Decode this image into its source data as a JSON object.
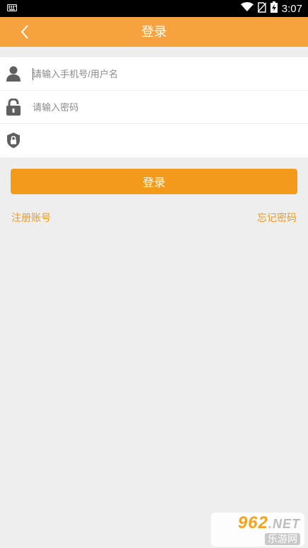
{
  "status_bar": {
    "time": "3:07",
    "icons": [
      "keyboard-icon",
      "wifi-icon",
      "no-sim-icon",
      "battery-charging-icon"
    ]
  },
  "app_bar": {
    "title": "登录",
    "back_icon": "chevron-left-icon"
  },
  "form": {
    "username": {
      "placeholder": "请输入手机号/用户名",
      "value": "",
      "icon": "user-icon"
    },
    "password": {
      "placeholder": "请输入密码",
      "value": "",
      "icon": "lock-icon"
    },
    "captcha": {
      "placeholder": "",
      "value": "",
      "icon": "shield-lock-icon"
    }
  },
  "actions": {
    "login_label": "登录",
    "register_label": "注册账号",
    "forgot_label": "忘记密码"
  },
  "watermark": {
    "brand": "962",
    "suffix": ".NET",
    "subtitle": "乐游网"
  },
  "colors": {
    "accent": "#f6a23f",
    "button": "#f39a1a",
    "background": "#eeeeee"
  }
}
